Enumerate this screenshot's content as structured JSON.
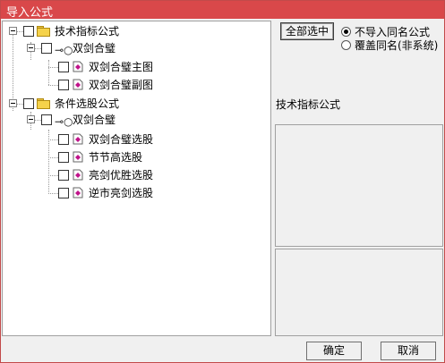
{
  "window": {
    "title": "导入公式"
  },
  "tree": {
    "groups": [
      {
        "label": "技术指标公式",
        "folders": [
          {
            "label": "双剑合璧",
            "items": [
              "双剑合璧主图",
              "双剑合璧副图"
            ]
          }
        ]
      },
      {
        "label": "条件选股公式",
        "folders": [
          {
            "label": "双剑合璧",
            "items": [
              "双剑合璧选股",
              "节节高选股",
              "亮剑优胜选股",
              "逆市亮剑选股"
            ]
          }
        ]
      }
    ]
  },
  "select_all_label": "全部选中",
  "options": {
    "no_import_label": "不导入同名公式",
    "overwrite_label": "覆盖同名(非系统)",
    "selected": "no_import"
  },
  "info": {
    "type_label": "技术指标公式"
  },
  "footer": {
    "ok_label": "确定",
    "cancel_label": "取消"
  },
  "colors": {
    "titlebar": "#d9484a",
    "doc_icon": "#c0138a"
  }
}
